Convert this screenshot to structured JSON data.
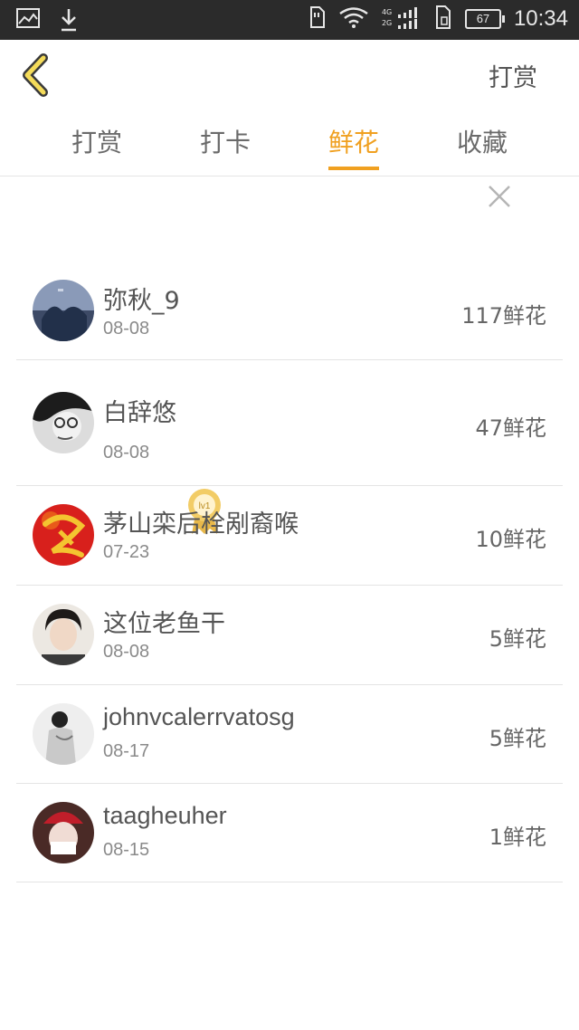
{
  "status_bar": {
    "time": "10:34",
    "battery": "67",
    "network_4g": "4G",
    "network_2g": "2G",
    "icons": [
      "gallery-icon",
      "download-icon",
      "sim-icon",
      "wifi-icon",
      "signal-icon",
      "phone-storage-icon",
      "battery-icon"
    ]
  },
  "header": {
    "back_icon": "chevron-left-icon",
    "right_label": "打赏"
  },
  "tabs": [
    {
      "label": "打赏",
      "active": false
    },
    {
      "label": "打卡",
      "active": false
    },
    {
      "label": "鲜花",
      "active": true
    },
    {
      "label": "收藏",
      "active": false
    }
  ],
  "accent_color": "#f0a020",
  "close_icon": "close-icon",
  "list": [
    {
      "name": "弥秋_9",
      "date": "08-08",
      "amount": "117鲜花",
      "badge": null
    },
    {
      "name": "白辞悠",
      "date": "08-08",
      "amount": "47鲜花",
      "badge": "lv1"
    },
    {
      "name": "茅山栾后栓剐裔喉",
      "date": "07-23",
      "amount": "10鲜花",
      "badge": null
    },
    {
      "name": "这位老鱼干",
      "date": "08-08",
      "amount": "5鲜花",
      "badge": null
    },
    {
      "name": "johnvcalerrvatosg",
      "date": "08-17",
      "amount": "5鲜花",
      "badge": null
    },
    {
      "name": "taagheuher",
      "date": "08-15",
      "amount": "1鲜花",
      "badge": null
    }
  ]
}
